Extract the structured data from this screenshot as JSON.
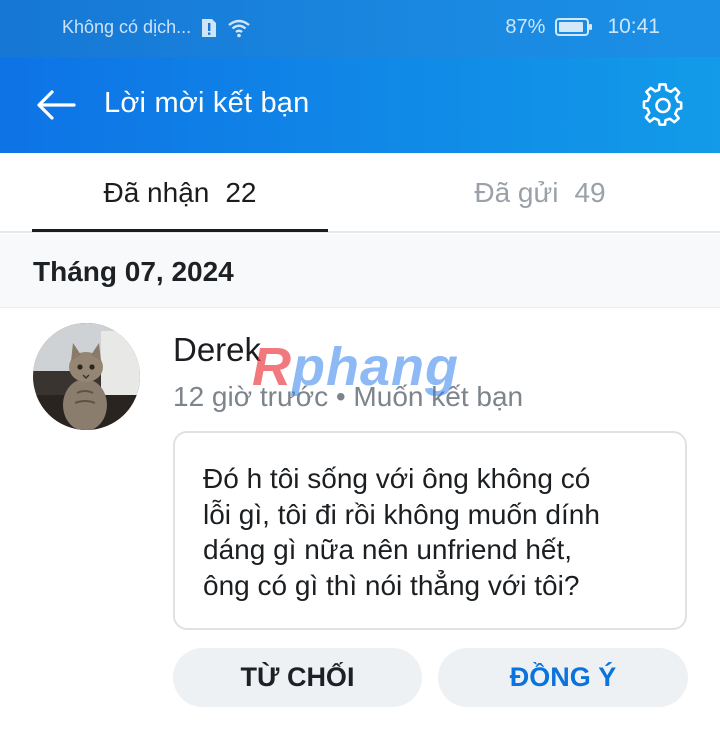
{
  "status_bar": {
    "carrier": "Không có dịch...",
    "battery": "87%",
    "time": "10:41"
  },
  "header": {
    "title": "Lời mời kết bạn",
    "back_icon": "arrow-left-icon",
    "settings_icon": "gear-icon"
  },
  "tabs": [
    {
      "label": "Đã nhận",
      "count": "22",
      "active": true
    },
    {
      "label": "Đã gửi",
      "count": "49",
      "active": false
    }
  ],
  "section": {
    "title": "Tháng 07, 2024"
  },
  "request": {
    "name": "Derek",
    "meta": "12 giờ trước • Muốn kết bạn",
    "message_lines": [
      "Đó h tôi sống với ông không có",
      "lỗi gì, tôi đi rồi không muốn dính",
      "dáng gì nữa nên unfriend hết,",
      "ông có gì thì nói thẳng với tôi?"
    ],
    "decline_label": "TỪ CHỐI",
    "accept_label": "ĐỒNG Ý"
  },
  "watermark": {
    "prefix": "R",
    "rest": "phang"
  },
  "colors": {
    "header_start": "#0e73e6",
    "header_end": "#129be8",
    "accept_text": "#0a74dc",
    "button_bg": "#eef1f4"
  }
}
